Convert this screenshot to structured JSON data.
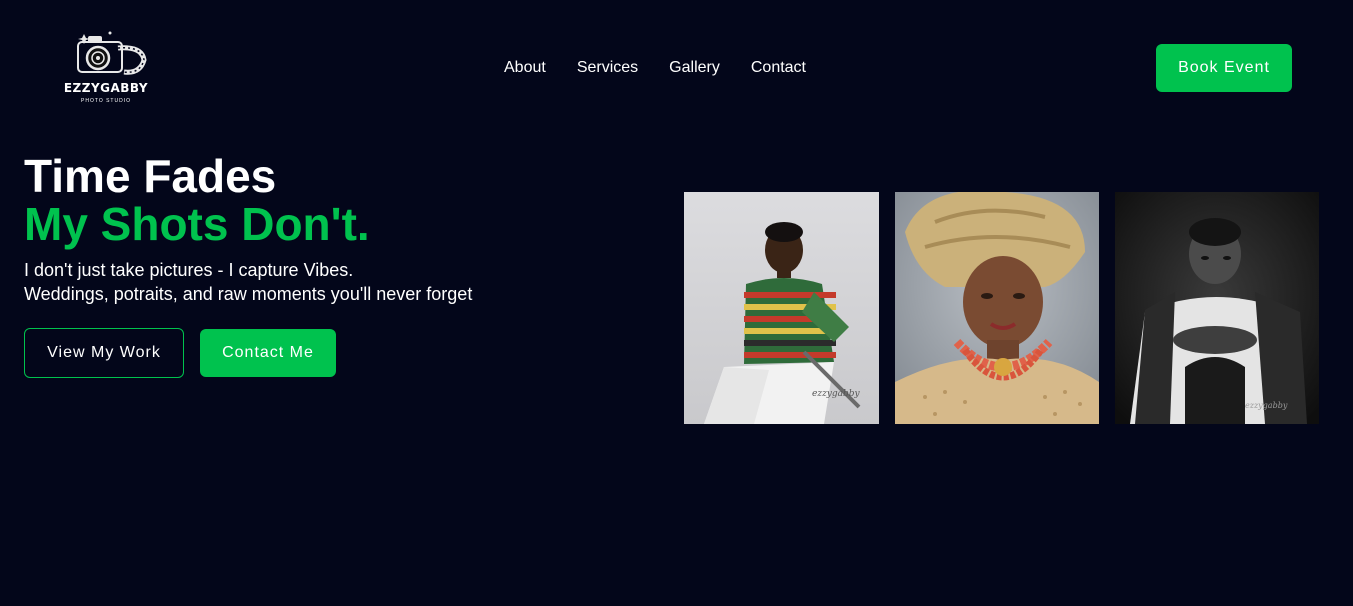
{
  "brand": {
    "name": "EZZYGABBY",
    "tagline": "PHOTO STUDIO"
  },
  "nav": {
    "items": [
      {
        "label": "About"
      },
      {
        "label": "Services"
      },
      {
        "label": "Gallery"
      },
      {
        "label": "Contact"
      }
    ]
  },
  "header": {
    "book_label": "Book Event"
  },
  "hero": {
    "title_line1": "Time Fades",
    "title_line2": "My Shots Don't.",
    "subtitle_line1": "I don't just take pictures - I capture Vibes.",
    "subtitle_line2": "Weddings, potraits, and raw moments you'll never forget",
    "primary_button": "View My Work",
    "secondary_button": "Contact Me"
  },
  "gallery": {
    "photos": [
      {
        "subject": "boy in striped shirt"
      },
      {
        "subject": "woman in gele headwrap with coral beads"
      },
      {
        "subject": "black and white portrait of boy"
      }
    ]
  },
  "colors": {
    "background": "#03061a",
    "accent": "#00c24e",
    "text": "#ffffff"
  },
  "icons": [
    "camera-logo-icon"
  ]
}
